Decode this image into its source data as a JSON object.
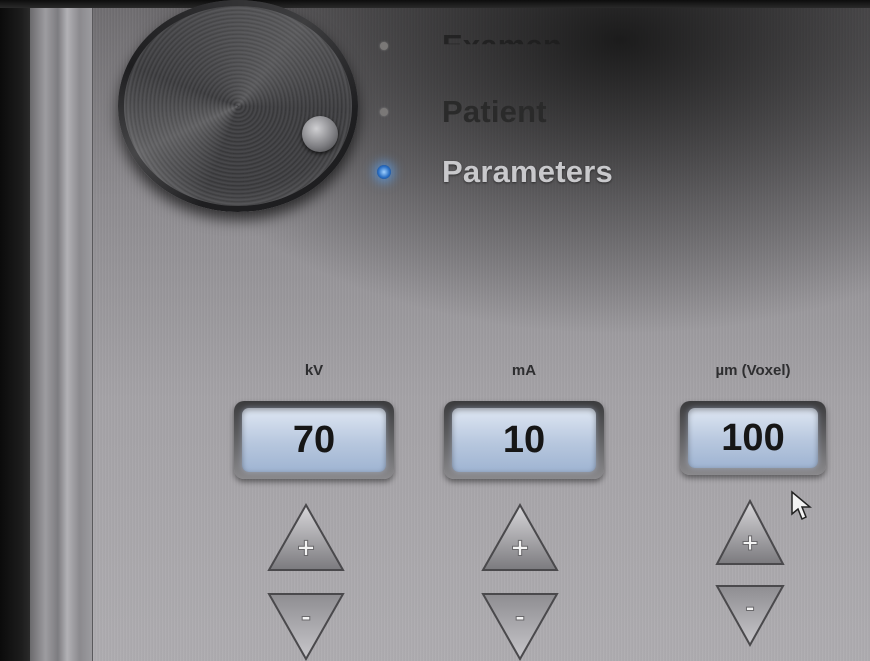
{
  "menu": {
    "items": [
      {
        "label": "Examen",
        "state": "partial"
      },
      {
        "label": "Patient",
        "state": "inactive"
      },
      {
        "label": "Parameters",
        "state": "active"
      }
    ]
  },
  "parameters": [
    {
      "label": "kV",
      "value": "70"
    },
    {
      "label": "mA",
      "value": "10"
    },
    {
      "label": "µm (Voxel)",
      "value": "100"
    }
  ],
  "buttons": {
    "increment": "+",
    "decrement": "-"
  },
  "colors": {
    "active_led": "#2a6fc4",
    "display_bg": "#c0cfe4"
  }
}
